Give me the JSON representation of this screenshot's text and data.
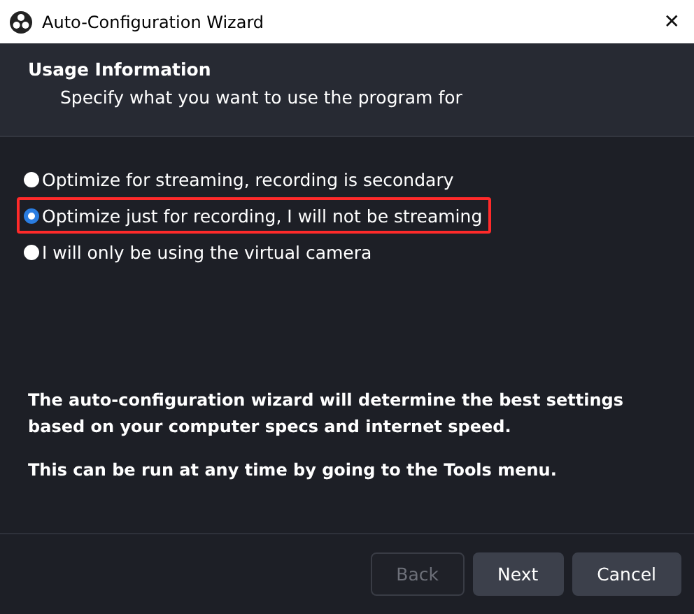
{
  "window": {
    "title": "Auto-Configuration Wizard",
    "close": "✕"
  },
  "header": {
    "title": "Usage Information",
    "subtitle": "Specify what you want to use the program for"
  },
  "options": [
    {
      "label": "Optimize for streaming, recording is secondary",
      "selected": false,
      "highlighted": false
    },
    {
      "label": "Optimize just for recording, I will not be streaming",
      "selected": true,
      "highlighted": true
    },
    {
      "label": "I will only be using the virtual camera",
      "selected": false,
      "highlighted": false
    }
  ],
  "notes": [
    "The auto-configuration wizard will determine the best settings based on your computer specs and internet speed.",
    "This can be run at any time by going to the Tools menu."
  ],
  "buttons": [
    {
      "label": "Back",
      "disabled": true
    },
    {
      "label": "Next",
      "disabled": false
    },
    {
      "label": "Cancel",
      "disabled": false
    }
  ]
}
